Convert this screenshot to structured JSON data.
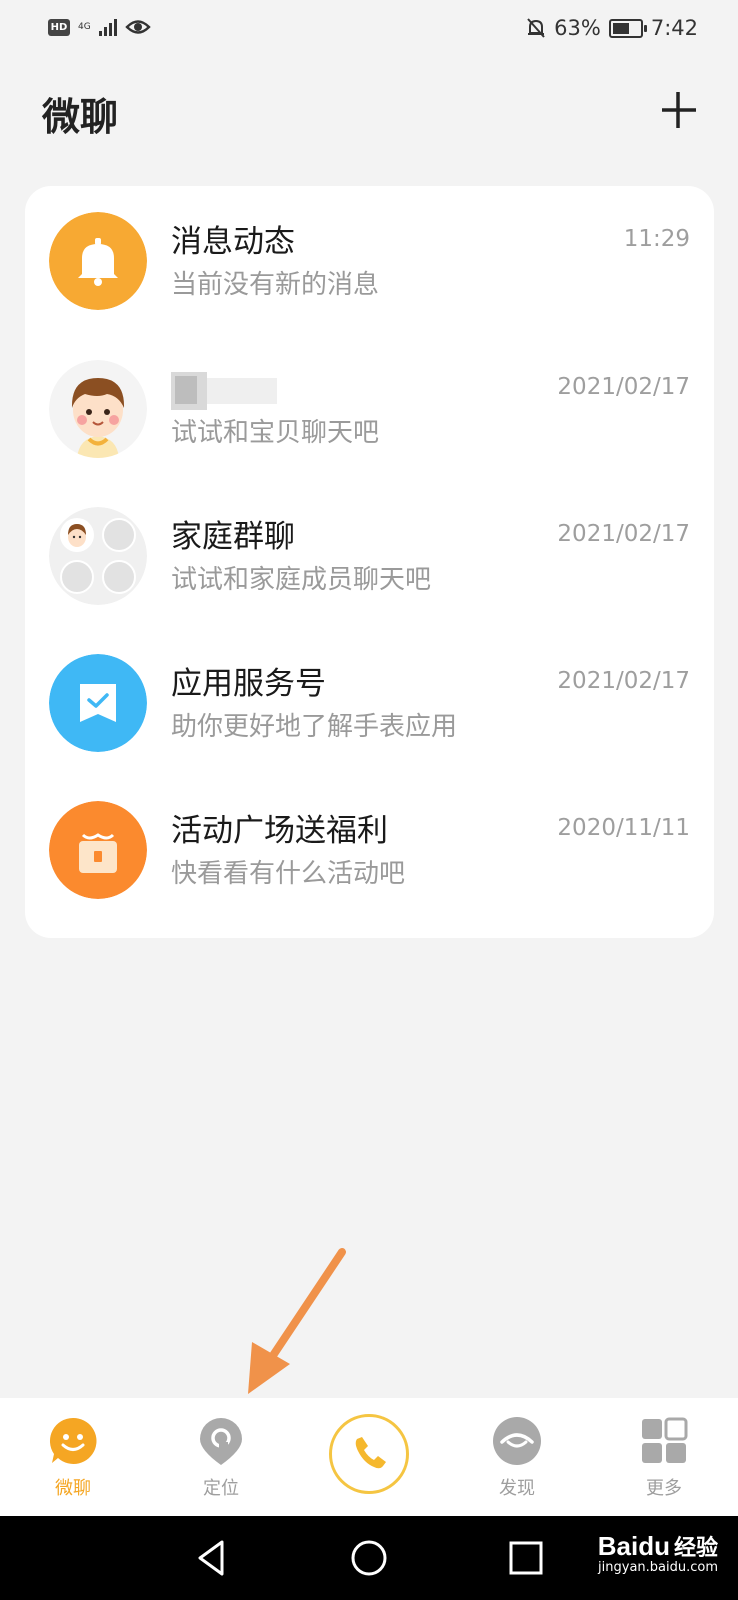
{
  "status_bar": {
    "network": "HD",
    "network_type": "4G",
    "battery": "63%",
    "battery_level": 0.63,
    "time": "7:42"
  },
  "header": {
    "title": "微聊"
  },
  "conversations": [
    {
      "name": "消息动态",
      "preview": "当前没有新的消息",
      "time": "11:29"
    },
    {
      "name": "",
      "preview": "试试和宝贝聊天吧",
      "time": "2021/02/17"
    },
    {
      "name": "家庭群聊",
      "preview": "试试和家庭成员聊天吧",
      "time": "2021/02/17"
    },
    {
      "name": "应用服务号",
      "preview": "助你更好地了解手表应用",
      "time": "2021/02/17"
    },
    {
      "name": "活动广场送福利",
      "preview": "快看看有什么活动吧",
      "time": "2020/11/11"
    }
  ],
  "tabs": [
    {
      "label": "微聊",
      "icon": "chat-smile-icon",
      "active": true
    },
    {
      "label": "定位",
      "icon": "location-pin-icon",
      "active": false
    },
    {
      "label": "",
      "icon": "phone-icon",
      "active": false
    },
    {
      "label": "发现",
      "icon": "eye-discover-icon",
      "active": false
    },
    {
      "label": "更多",
      "icon": "grid-more-icon",
      "active": false
    }
  ],
  "watermark": {
    "brand": "Baidu",
    "cn": "经验",
    "url": "jingyan.baidu.com"
  },
  "colors": {
    "accent": "#f5a623",
    "bell_bg": "#f7a933",
    "service_bg": "#3fb8f5",
    "gift_bg": "#fb8a2e",
    "arrow": "#f0924a"
  }
}
